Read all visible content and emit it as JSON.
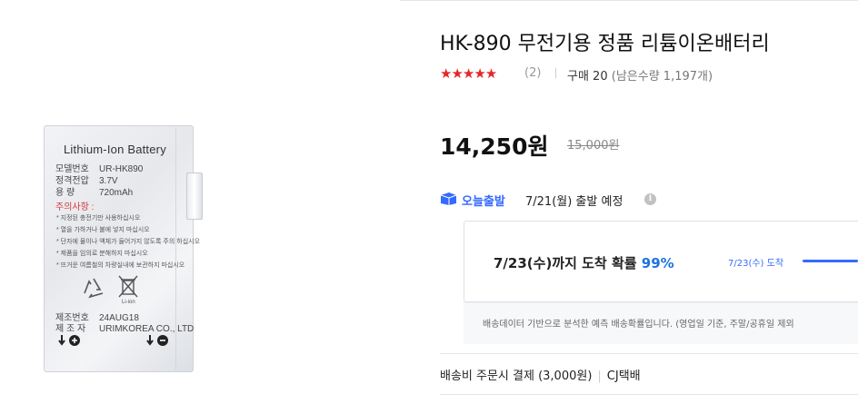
{
  "product_image": {
    "label_title": "Lithium-Ion Battery",
    "specs": [
      {
        "key": "모델번호",
        "value": "UR-HK890"
      },
      {
        "key": "정격전압",
        "value": "3.7V"
      },
      {
        "key": "용    량",
        "value": "720mAh"
      }
    ],
    "caution_title": "주의사항 :",
    "cautions": [
      "* 지정된 충전기만 사용하십시오",
      "* 열을 가하거나 불에 넣지 마십시오",
      "* 단자에 물이나 액체가 들어가지 않도록 주의 하십시오",
      "* 제품을 임의로 분해하지 마십시오",
      "* 뜨거운 여름철의 차량실내에 보관하지 마십시오"
    ],
    "li_ion_mark": "Li-ion",
    "manufacture": [
      {
        "key": "제조번호",
        "value": "24AUG18"
      },
      {
        "key": "제 조 자",
        "value": "URIMKOREA CO., LTD"
      }
    ]
  },
  "product": {
    "title": "HK-890 무전기용 정품 리튬이온배터리",
    "rating_stars": "★★★★★",
    "rating": 5,
    "review_count": "(2)",
    "purchases": "구매 20",
    "stock": "(남은수량 1,197개)",
    "price": "14,250원",
    "original_price": "15,000원"
  },
  "shipping": {
    "badge": "오늘출발",
    "eta": "7/21(월) 출발 예정",
    "info_icon": "i",
    "arrival_text": "7/23(수)까지 도착 확률",
    "arrival_prob": "99%",
    "arrival_chip": "7/23(수) 도착",
    "notice": "배송데이터 기반으로 분석한 예측 배송확률입니다. (영업일 기준, 주말/공휴일 제외",
    "fee": "배송비 주문시 결제 (3,000원)",
    "carrier": "CJ택배"
  },
  "colors": {
    "star": "#e52528",
    "accent_blue": "#346aff",
    "prob_blue": "#1f72de"
  }
}
